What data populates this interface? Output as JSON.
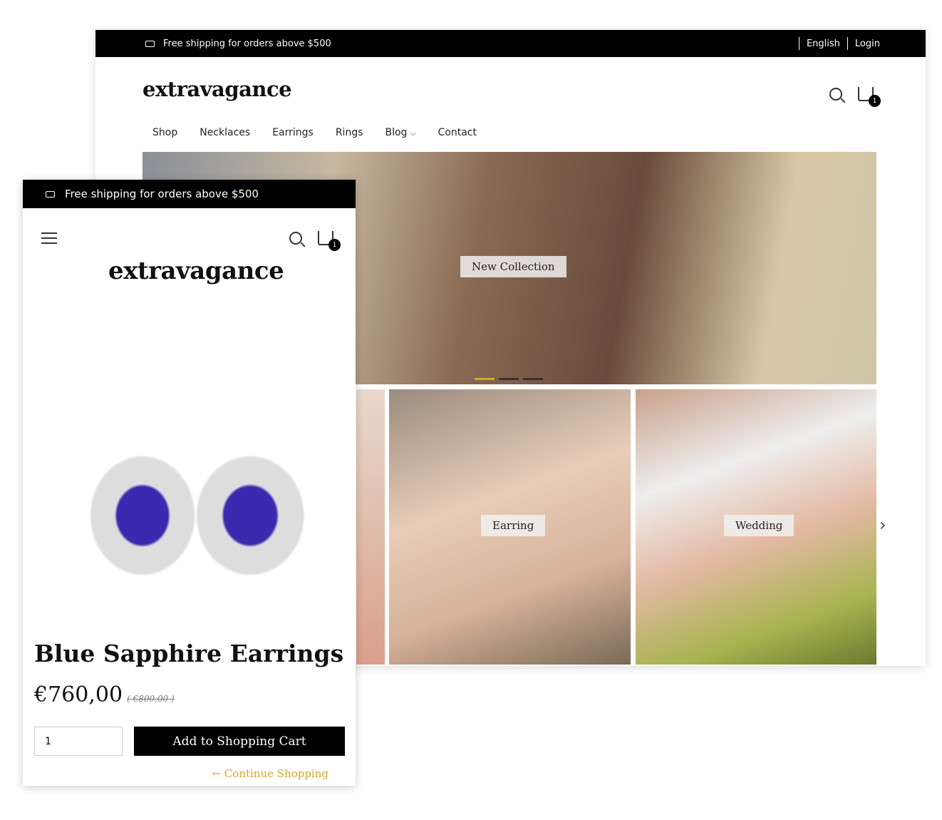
{
  "desktop": {
    "shipping": "Free shipping for orders above $500",
    "language": "English",
    "login": "Login",
    "logo": "extravagance",
    "cart_count": "1",
    "nav": [
      "Shop",
      "Necklaces",
      "Earrings",
      "Rings",
      "Blog",
      "Contact"
    ],
    "hero_label": "New Collection",
    "tiles": [
      "Earring",
      "Wedding"
    ],
    "accent": "#d4a72c"
  },
  "mobile": {
    "shipping": "Free shipping for orders above $500",
    "logo": "extravagance",
    "cart_count": "1",
    "product_title": "Blue Sapphire Earrings",
    "price": "€760,00",
    "old_price": "( €800,00 )",
    "quantity": "1",
    "add_to_cart": "Add to Shopping Cart",
    "continue": "← Continue Shopping"
  }
}
